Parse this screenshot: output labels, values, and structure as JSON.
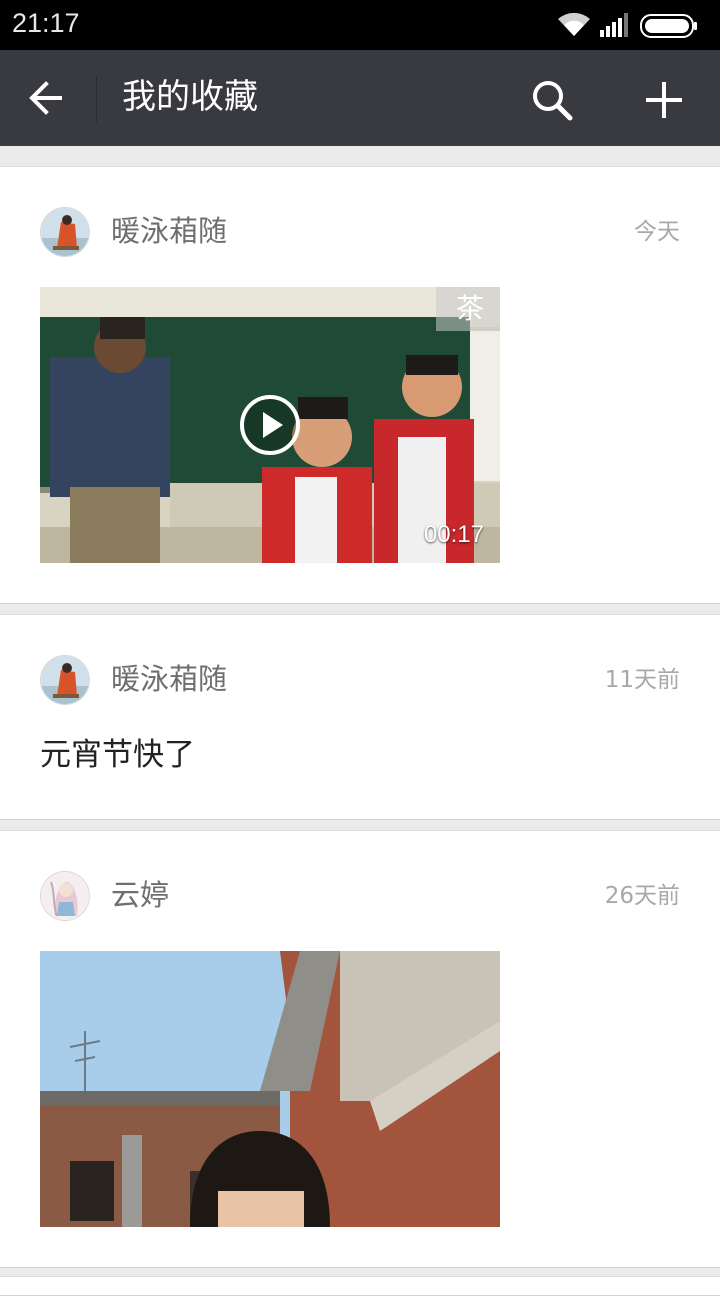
{
  "status_bar": {
    "time": "21:17",
    "icons": [
      "wifi-icon",
      "signal-icon",
      "battery-icon"
    ]
  },
  "header": {
    "title": "我的收藏",
    "back_icon": "arrow-left-icon",
    "search_icon": "search-icon",
    "add_icon": "plus-icon"
  },
  "favorites": [
    {
      "author": "暖泳葙随",
      "time": "今天",
      "type": "video",
      "duration": "00:17",
      "watermark": "茶"
    },
    {
      "author": "暖泳葙随",
      "time": "11天前",
      "type": "text",
      "text": "元宵节快了"
    },
    {
      "author": "云婷",
      "time": "26天前",
      "type": "image"
    }
  ],
  "colors": {
    "app_bar": "#393a3f",
    "status_bar": "#000000",
    "background": "#ebebeb",
    "card": "#ffffff"
  }
}
